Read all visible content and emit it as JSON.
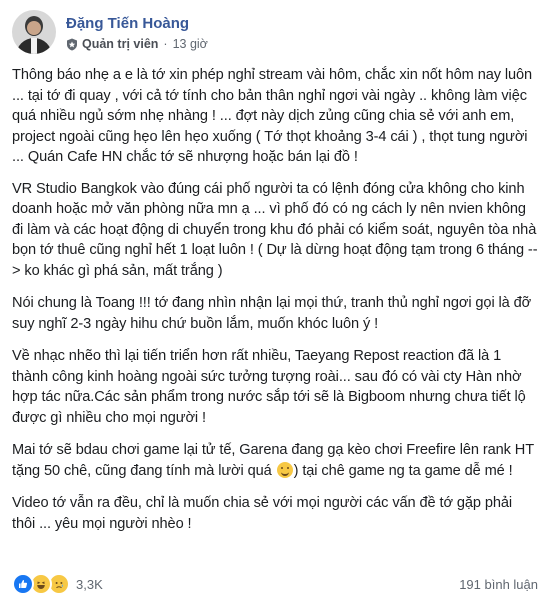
{
  "post": {
    "author": "Đặng Tiến Hoàng",
    "role": "Quản trị viên",
    "time": "13 giờ",
    "separator": "·",
    "paragraphs": [
      "Thông báo nhẹ a e là tớ xin phép nghỉ stream vài hôm, chắc xin nốt hôm nay luôn ... tại tớ đi quay , với cả tớ tính cho bản thân nghỉ ngơi vài ngày .. không làm việc quá nhiều ngủ sớm nhẹ nhàng ! ... đợt này dịch zủng cũng chia sẻ với anh em, project ngoài cũng hẹo lên hẹo xuống ( Tớ thọt khoảng 3-4 cái ) , thọt tung người ... Quán Cafe HN chắc tớ sẽ nhượng hoặc bán lại đồ !",
      "VR Studio Bangkok vào đúng cái phố người ta có lệnh đóng cửa không cho kinh doanh hoặc mở văn phòng nữa mn ạ ... vì phố đó có ng cách ly nên nvien không đi làm và các hoạt động di chuyển trong khu đó phải có kiểm soát, nguyên tòa nhà bọn tớ thuê cũng nghỉ hết 1 loạt luôn ! ( Dự là dừng hoạt động tạm trong 6 tháng -- > ko khác gì phá sản, mất trắng )",
      "Nói chung là Toang !!! tớ đang nhìn nhận lại mọi thứ, tranh thủ nghỉ ngơi gọi là đỡ suy nghĩ 2-3 ngày hihu chứ buồn lắm, muốn khóc luôn ý !",
      "Về nhạc nhẽo thì lại tiến triển hơn rất nhiều, Taeyang Repost reaction đã là 1 thành công kinh hoàng ngoài sức tưởng tượng roài... sau đó có vài cty Hàn nhờ hợp tác nữa.Các sản phẩm trong nước sắp tới sẽ là Bigboom nhưng chưa tiết lộ được gì nhiều cho mọi người !",
      "Video tớ vẫn ra đều, chỉ là muốn chia sẻ với mọi người các vấn đề tớ gặp phải thôi ... yêu mọi người nhèo !"
    ],
    "game_paragraph_before": "Mai tớ sẽ bdau chơi game lại tử tế, Garena đang gạ kèo chơi Freefire lên rank HT tặng 50 chê, cũng đang tính mà lười quá ",
    "game_paragraph_after": ") tại chê game ng ta game dễ mé !",
    "reaction_count": "3,3K",
    "comment_count": "191 bình luận"
  }
}
